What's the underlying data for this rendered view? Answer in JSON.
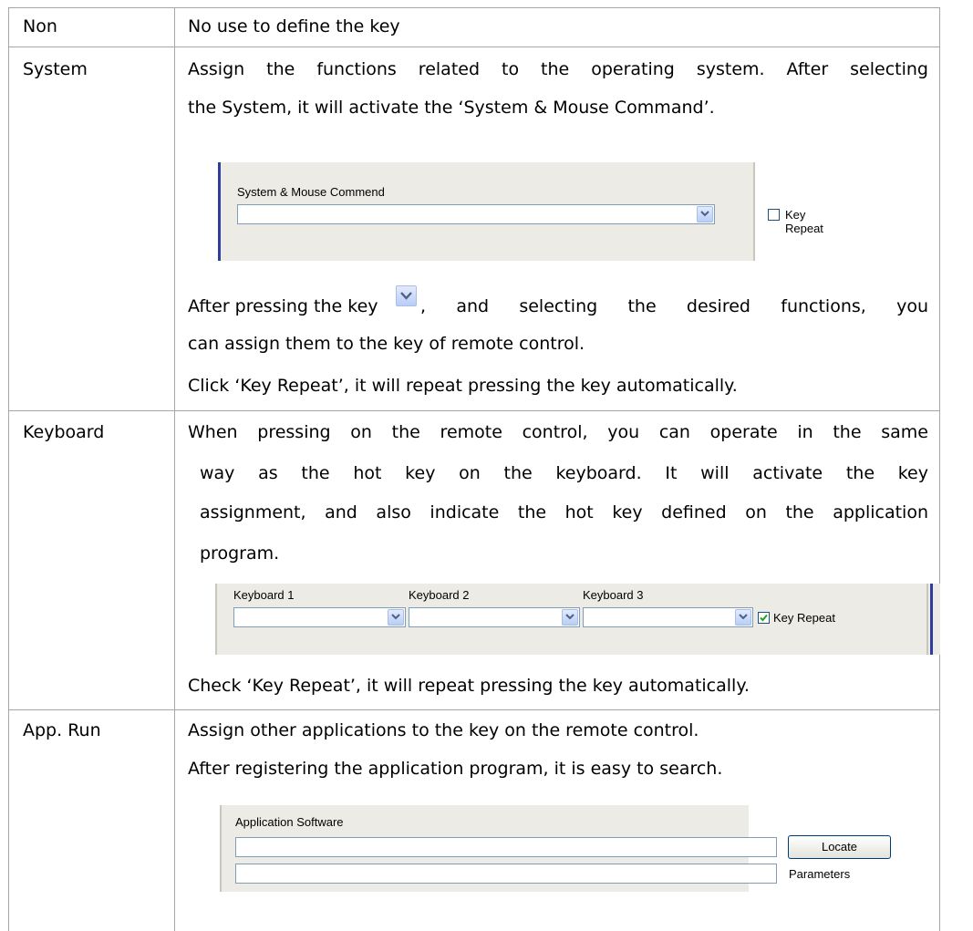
{
  "rows": [
    {
      "term": "Non",
      "lines": [
        "No use to define the key"
      ]
    },
    {
      "term": "System",
      "lines": [
        "Assign the functions related to the operating system. After selecting",
        "the System, it will activate the ‘System & Mouse Command’."
      ],
      "dialog": {
        "label": "System & Mouse Commend",
        "checkbox_label": "Key Repeat",
        "checked": false
      },
      "after_lines": [
        "After pressing the key",
        ", and selecting the desired functions, you",
        "can assign them to the key of remote control.",
        "Click ‘Key Repeat’, it will repeat pressing the key automatically."
      ]
    },
    {
      "term": "Keyboard",
      "lines": [
        "When pressing on the remote control, you can operate in the same",
        "way as the hot key on the keyboard. It will activate the key",
        "assignment, and also indicate the hot key defined on the application",
        "program."
      ],
      "dialog": {
        "labels": [
          "Keyboard 1",
          "Keyboard 2",
          "Keyboard 3"
        ],
        "checkbox_label": "Key Repeat",
        "checked": true
      },
      "after_lines": [
        "Check ‘Key Repeat’, it will repeat pressing the key automatically."
      ]
    },
    {
      "term": "App. Run",
      "lines": [
        "Assign other applications to the key on the remote control.",
        "After registering the application program, it is easy to search."
      ],
      "dialog": {
        "label": "Application Software",
        "button_label": "Locate",
        "parameters_label": "Parameters"
      }
    }
  ],
  "colors": {
    "border": "#a6a6a6",
    "panel": "#ecebe5",
    "accent": "#2f3d9e",
    "check": "#21a121"
  }
}
